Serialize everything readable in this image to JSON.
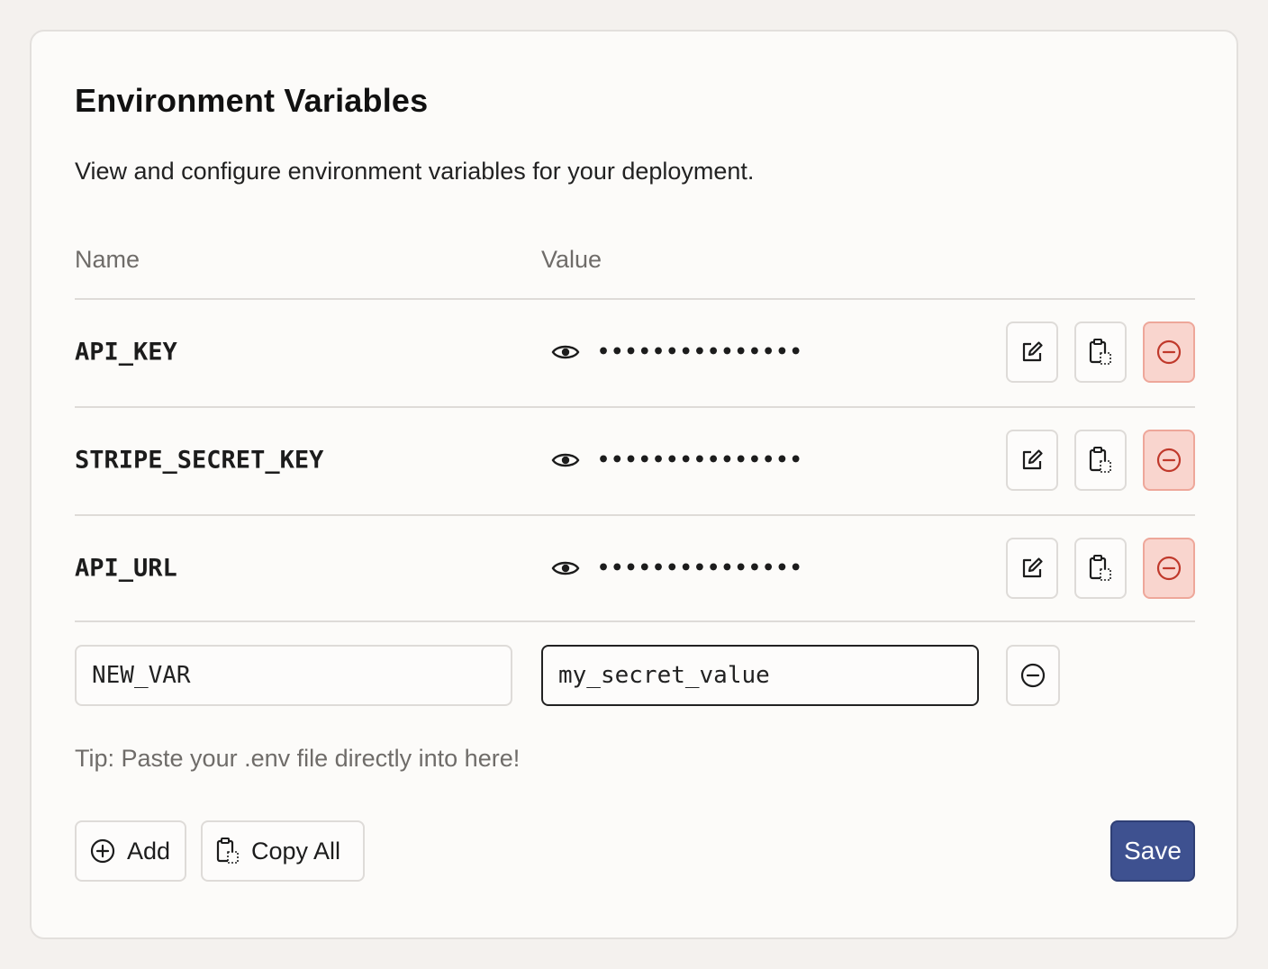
{
  "header": {
    "title": "Environment Variables",
    "subtitle": "View and configure environment variables for your deployment."
  },
  "table": {
    "columns": [
      "Name",
      "Value"
    ],
    "rows": [
      {
        "name": "API_KEY",
        "masked_value": "•••••••••••••••"
      },
      {
        "name": "STRIPE_SECRET_KEY",
        "masked_value": "•••••••••••••••"
      },
      {
        "name": "API_URL",
        "masked_value": "•••••••••••••••"
      }
    ],
    "row_actions": [
      "edit-icon",
      "clipboard-icon",
      "minus-circle-icon"
    ]
  },
  "new_row": {
    "name_value": "NEW_VAR",
    "value_value": "my_secret_value"
  },
  "tip": "Tip: Paste your .env file directly into here!",
  "footer": {
    "add_label": "Add",
    "copy_all_label": "Copy All",
    "save_label": "Save"
  },
  "colors": {
    "accent": "#3e5190",
    "danger_bg": "#f9d5ce",
    "danger_border": "#eea79a",
    "danger_icon": "#c0392b"
  }
}
